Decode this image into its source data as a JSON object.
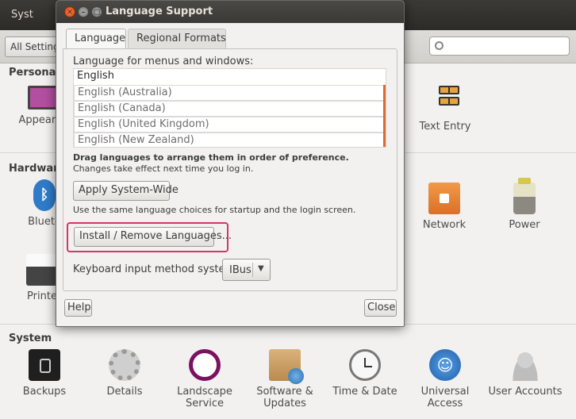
{
  "background": {
    "window_title": "Syst",
    "all_settings_label": "All Settings",
    "sections": {
      "personal": "Personal",
      "hardware": "Hardware",
      "system": "System"
    },
    "personal_items": [
      {
        "label": "Appearan",
        "icon": "appearance-icon"
      },
      {
        "label": "Text Entry",
        "icon": "text-entry-icon"
      }
    ],
    "hardware_items": [
      {
        "label": "Blueto",
        "icon": "bluetooth-icon"
      },
      {
        "label": "Network",
        "icon": "network-icon"
      },
      {
        "label": "Power",
        "icon": "power-icon"
      },
      {
        "label": "Printe",
        "icon": "printer-icon"
      }
    ],
    "system_items": [
      {
        "label": "Backups",
        "icon": "backups-icon"
      },
      {
        "label": "Details",
        "icon": "details-icon"
      },
      {
        "label": "Landscape Service",
        "icon": "landscape-icon"
      },
      {
        "label": "Software & Updates",
        "icon": "software-icon"
      },
      {
        "label": "Time & Date",
        "icon": "clock-icon"
      },
      {
        "label": "Universal Access",
        "icon": "accessibility-icon"
      },
      {
        "label": "User Accounts",
        "icon": "users-icon"
      }
    ]
  },
  "dialog": {
    "title": "Language Support",
    "tabs": [
      {
        "label": "Language",
        "active": true
      },
      {
        "label": "Regional Formats",
        "active": false
      }
    ],
    "language_heading": "Language for menus and windows:",
    "languages": [
      "English",
      "English (Australia)",
      "English (Canada)",
      "English (United Kingdom)",
      "English (New Zealand)"
    ],
    "drag_hint": "Drag languages to arrange them in order of preference.",
    "changes_hint": "Changes take effect next time you log in.",
    "apply_button": "Apply System-Wide",
    "same_choices_hint": "Use the same language choices for startup and the login screen.",
    "install_button": "Install / Remove Languages...",
    "keyboard_label": "Keyboard input method system:",
    "keyboard_value": "IBus",
    "help_button": "Help",
    "close_button": "Close",
    "highlight_color": "#d8336b",
    "accent_color": "#dd6a2f"
  }
}
